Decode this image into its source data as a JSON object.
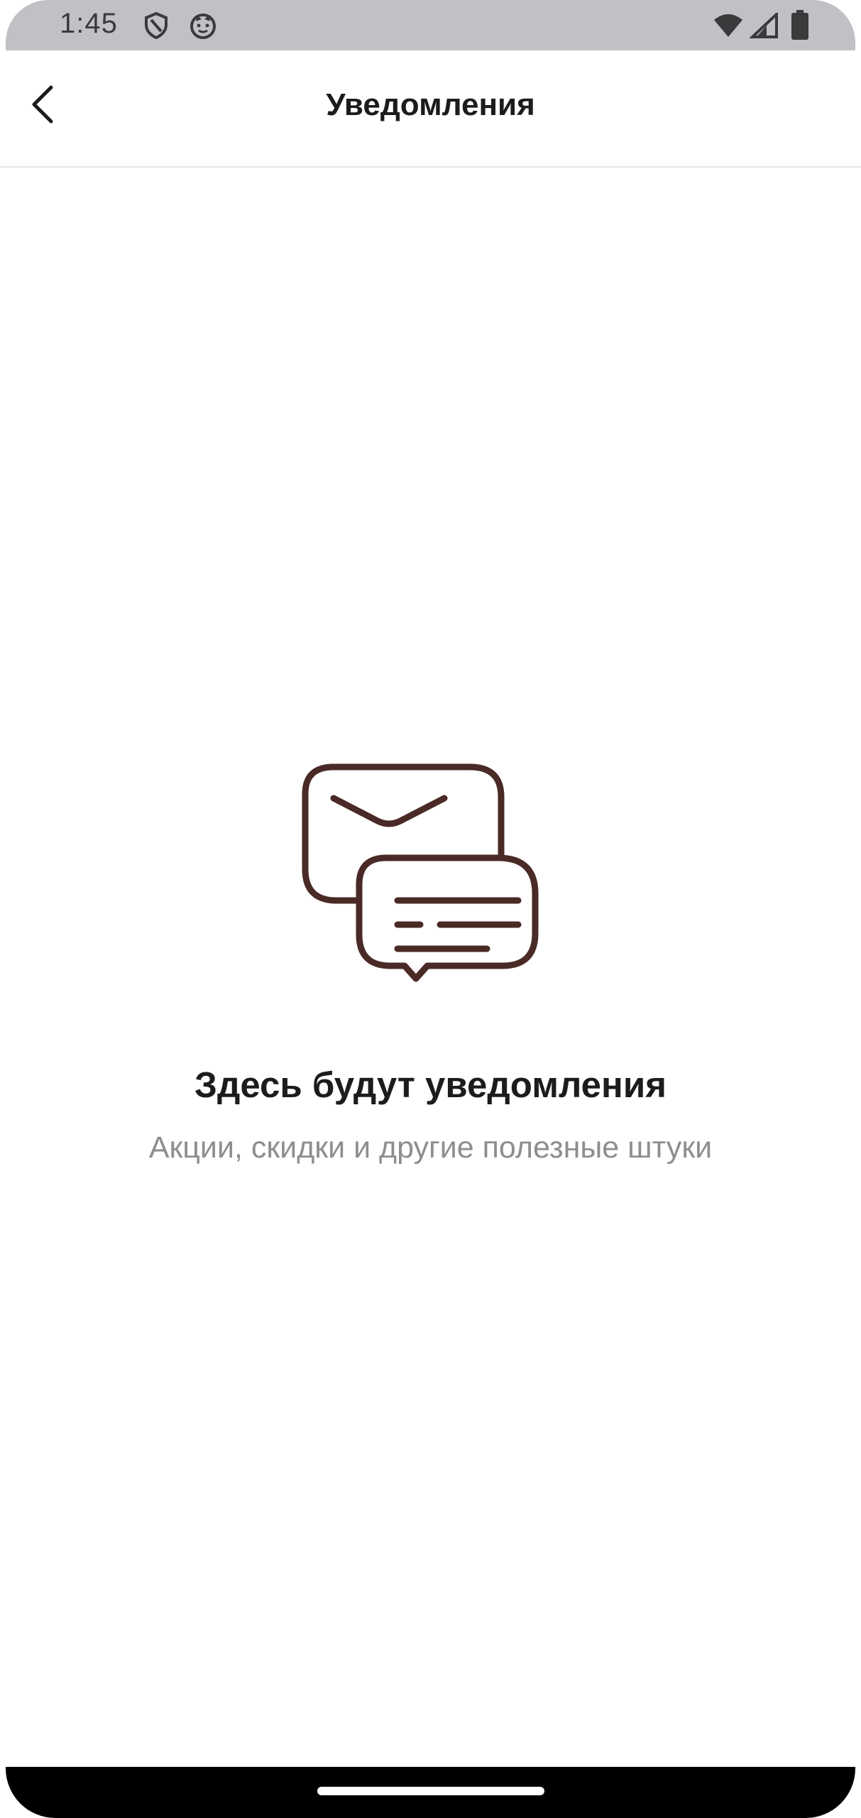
{
  "status_bar": {
    "time": "1:45",
    "icons": [
      "shield-icon",
      "cat-icon",
      "wifi-icon",
      "signal-icon",
      "battery-icon"
    ]
  },
  "app_bar": {
    "back_icon": "chevron-left-icon",
    "title": "Уведомления"
  },
  "empty_state": {
    "illustration": "chat-bubbles-envelope-icon",
    "title": "Здесь будут уведомления",
    "subtitle": "Акции, скидки и другие полезные штуки"
  },
  "colors": {
    "icon_stroke": "#4a2a26",
    "title_text": "#1c1c1e",
    "subtitle_text": "#8e8e8e",
    "status_bar_bg": "#c2c0c4"
  }
}
